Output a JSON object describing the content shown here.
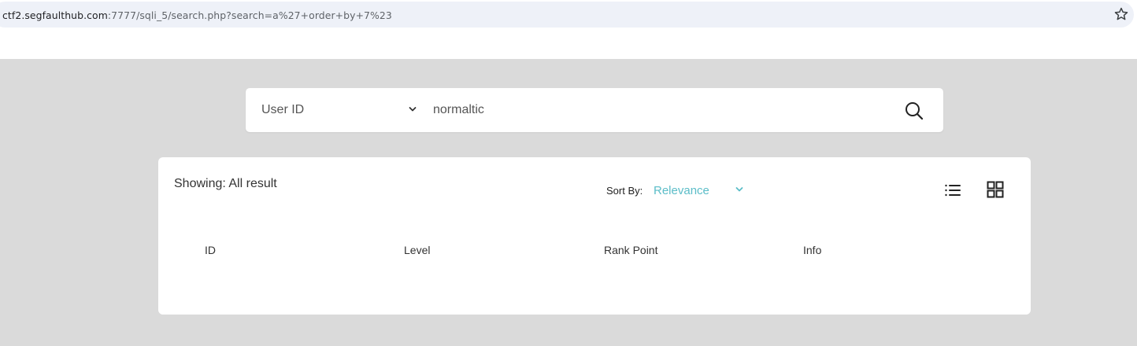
{
  "browser": {
    "url_host": "ctf2.segfaulthub.com",
    "url_rest": ":7777/sqli_5/search.php?search=a%27+order+by+7%23",
    "bookmark_icon": "star-outline-icon"
  },
  "search": {
    "field_selected": "User ID",
    "query_value": "normaltic",
    "search_icon": "magnifier-icon"
  },
  "results": {
    "showing_text": "Showing: All result",
    "sort_label": "Sort By:",
    "sort_value": "Relevance",
    "accent_color": "#5bbdc8",
    "columns": [
      "ID",
      "Level",
      "Rank Point",
      "Info"
    ]
  }
}
